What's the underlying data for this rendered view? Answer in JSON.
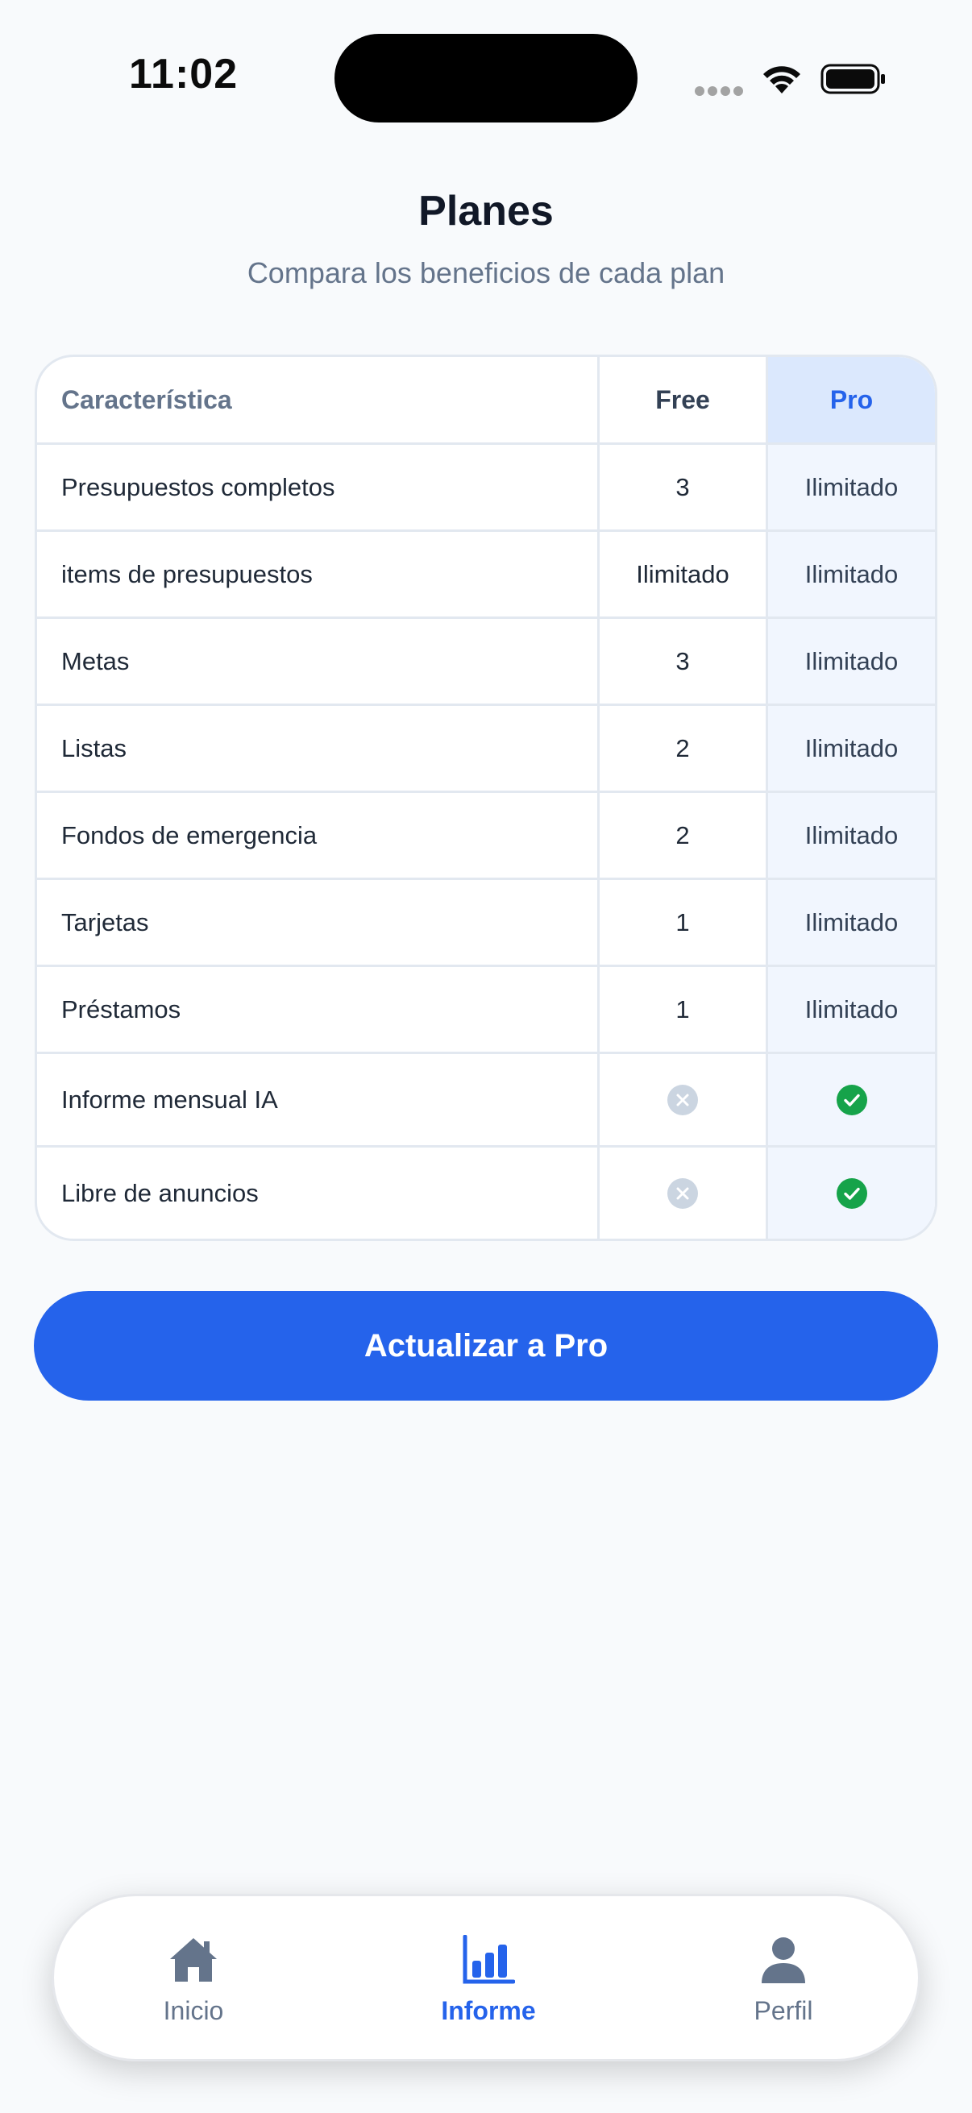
{
  "status_bar": {
    "time": "11:02"
  },
  "header": {
    "title": "Planes",
    "subtitle": "Compara los beneficios de cada plan"
  },
  "table": {
    "columns": [
      "Característica",
      "Free",
      "Pro"
    ],
    "rows": [
      {
        "feature": "Presupuestos completos",
        "free": "3",
        "pro": "Ilimitado"
      },
      {
        "feature": "items de presupuestos",
        "free": "Ilimitado",
        "pro": "Ilimitado"
      },
      {
        "feature": "Metas",
        "free": "3",
        "pro": "Ilimitado"
      },
      {
        "feature": "Listas",
        "free": "2",
        "pro": "Ilimitado"
      },
      {
        "feature": "Fondos de emergencia",
        "free": "2",
        "pro": "Ilimitado"
      },
      {
        "feature": "Tarjetas",
        "free": "1",
        "pro": "Ilimitado"
      },
      {
        "feature": "Préstamos",
        "free": "1",
        "pro": "Ilimitado"
      },
      {
        "feature": "Informe mensual IA",
        "free_icon": "x-circle-icon",
        "pro_icon": "check-circle-icon"
      },
      {
        "feature": "Libre de anuncios",
        "free_icon": "x-circle-icon",
        "pro_icon": "check-circle-icon"
      }
    ]
  },
  "upgrade_button": {
    "label": "Actualizar a Pro"
  },
  "bottom_nav": {
    "items": [
      {
        "label": "Inicio",
        "icon": "home-icon",
        "active": false
      },
      {
        "label": "Informe",
        "icon": "bar-chart-icon",
        "active": true
      },
      {
        "label": "Perfil",
        "icon": "user-icon",
        "active": false
      }
    ]
  },
  "colors": {
    "accent": "#2563eb",
    "background": "#f8fafc",
    "pro_column": "#f1f6fe",
    "pro_header": "#dbe8fd",
    "check": "#16a34a",
    "x_icon": "#cbd5e1"
  }
}
